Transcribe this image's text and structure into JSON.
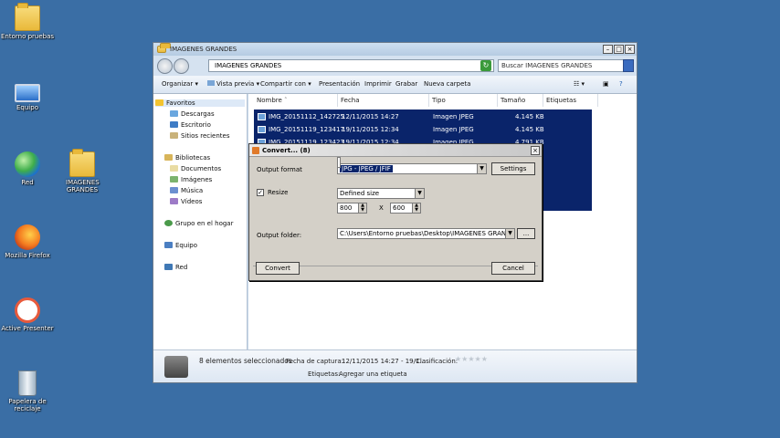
{
  "desktop": {
    "icons": [
      {
        "label": "Entorno pruebas",
        "icon": "folder-icon"
      },
      {
        "label": "Equipo",
        "icon": "computer-icon"
      },
      {
        "label": "Red",
        "icon": "network-icon"
      },
      {
        "label": "IMAGENES GRANDES",
        "icon": "folder-icon"
      },
      {
        "label": "Mozilla Firefox",
        "icon": "firefox-icon"
      },
      {
        "label": "Active Presenter",
        "icon": "activepresenter-icon"
      },
      {
        "label": "Papelera de reciclaje",
        "icon": "recycle-bin-icon"
      }
    ]
  },
  "explorer": {
    "title": "IMAGENES GRANDES",
    "address": "IMAGENES GRANDES",
    "search_placeholder": "Buscar IMAGENES GRANDES",
    "toolbar": {
      "organize": "Organizar",
      "preview": "Vista previa",
      "share": "Compartir con",
      "presentation": "Presentación",
      "print": "Imprimir",
      "burn": "Grabar",
      "new_folder": "Nueva carpeta"
    },
    "sidebar": {
      "favorites": "Favoritos",
      "downloads": "Descargas",
      "desktop": "Escritorio",
      "recent": "Sitios recientes",
      "libraries": "Bibliotecas",
      "documents": "Documentos",
      "images": "Imágenes",
      "music": "Música",
      "videos": "Vídeos",
      "homegroup": "Grupo en el hogar",
      "computer": "Equipo",
      "network": "Red"
    },
    "columns": {
      "name": "Nombre",
      "date": "Fecha",
      "type": "Tipo",
      "size": "Tamaño",
      "tags": "Etiquetas"
    },
    "files": [
      {
        "name": "IMG_20151112_142725",
        "date": "12/11/2015 14:27",
        "type": "Imagen JPEG",
        "size": "4.145 KB"
      },
      {
        "name": "IMG_20151119_123417",
        "date": "19/11/2015 12:34",
        "type": "Imagen JPEG",
        "size": "4.145 KB"
      },
      {
        "name": "IMG_20151119_123423",
        "date": "19/11/2015 12:34",
        "type": "Imagen JPEG",
        "size": "4.791 KB"
      }
    ],
    "status": {
      "selected": "8 elementos seleccionados",
      "capture_label": "Fecha de captura:",
      "capture_value": "12/11/2015 14:27 - 19/1...",
      "rating_label": "Clasificación:",
      "rating": 0,
      "tags_label": "Etiquetas:",
      "tags_value": "Agregar una etiqueta"
    }
  },
  "dialog": {
    "title": "Convert... (8)",
    "output_format_label": "Output format",
    "output_format_value": "JPG - JPEG / JFIF",
    "settings_button": "Settings",
    "resize_label": "Resize",
    "resize_checked": true,
    "resize_mode": "Defined size",
    "width": "800",
    "times": "X",
    "height": "600",
    "output_folder_label": "Output folder:",
    "output_folder_value": "C:\\Users\\Entorno pruebas\\Desktop\\IMAGENES GRANDES\\",
    "browse_button": "...",
    "convert_button": "Convert",
    "cancel_button": "Cancel"
  }
}
